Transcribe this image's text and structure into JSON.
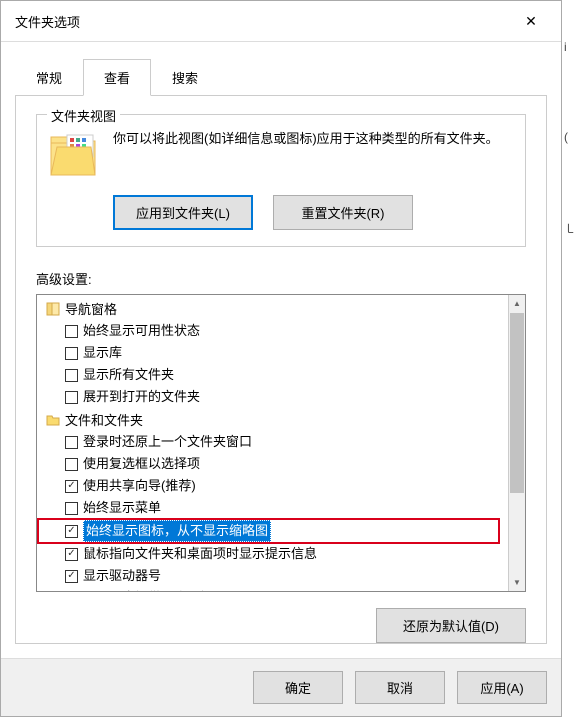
{
  "window": {
    "title": "文件夹选项",
    "close": "✕"
  },
  "tabs": {
    "general": "常规",
    "view": "查看",
    "search": "搜索"
  },
  "folderView": {
    "groupTitle": "文件夹视图",
    "description": "你可以将此视图(如详细信息或图标)应用于这种类型的所有文件夹。",
    "applyBtn": "应用到文件夹(L)",
    "resetBtn": "重置文件夹(R)"
  },
  "advanced": {
    "label": "高级设置:",
    "navGroup": "导航窗格",
    "navItems": [
      {
        "label": "始终显示可用性状态",
        "checked": false
      },
      {
        "label": "显示库",
        "checked": false
      },
      {
        "label": "显示所有文件夹",
        "checked": false
      },
      {
        "label": "展开到打开的文件夹",
        "checked": false
      }
    ],
    "fileGroup": "文件和文件夹",
    "fileItems": [
      {
        "label": "登录时还原上一个文件夹窗口",
        "checked": false
      },
      {
        "label": "使用复选框以选择项",
        "checked": false
      },
      {
        "label": "使用共享向导(推荐)",
        "checked": true
      },
      {
        "label": "始终显示菜单",
        "checked": false
      },
      {
        "label": "始终显示图标，从不显示缩略图",
        "checked": true,
        "highlighted": true
      },
      {
        "label": "鼠标指向文件夹和桌面项时显示提示信息",
        "checked": true
      },
      {
        "label": "显示驱动器号",
        "checked": true
      },
      {
        "label": "显示同步提供程序通知",
        "checked": true
      }
    ],
    "restoreBtn": "还原为默认值(D)"
  },
  "footer": {
    "ok": "确定",
    "cancel": "取消",
    "apply": "应用(A)"
  },
  "sidebar": {
    "i": "i",
    "paren": "(",
    "b": "㇄"
  }
}
